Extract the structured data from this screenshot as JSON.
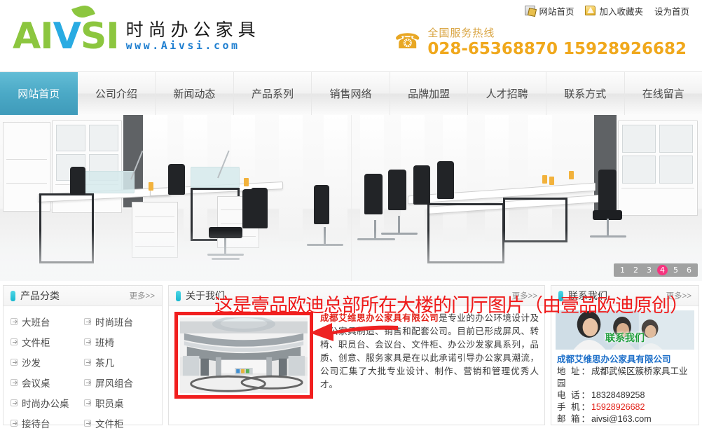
{
  "topbar": {
    "items": [
      {
        "icon": "home-icon",
        "label": "网站首页"
      },
      {
        "icon": "favorite-folder-icon",
        "label": "加入收藏夹"
      },
      {
        "icon": "",
        "label": "设为首页"
      }
    ]
  },
  "brand": {
    "logo_main": "AI",
    "logo_v": "V",
    "logo_tail": "SI",
    "logo_cn": "时尚办公家具",
    "logo_url": "www.Aivsi.com"
  },
  "hotline": {
    "label": "全国服务热线",
    "numbers": "028-65368870  15928926682"
  },
  "nav": {
    "items": [
      {
        "label": "网站首页",
        "active": true
      },
      {
        "label": "公司介绍",
        "active": false
      },
      {
        "label": "新闻动态",
        "active": false
      },
      {
        "label": "产品系列",
        "active": false
      },
      {
        "label": "销售网络",
        "active": false
      },
      {
        "label": "品牌加盟",
        "active": false
      },
      {
        "label": "人才招聘",
        "active": false
      },
      {
        "label": "联系方式",
        "active": false
      },
      {
        "label": "在线留言",
        "active": false
      }
    ]
  },
  "banner": {
    "pages": [
      "1",
      "2",
      "3",
      "4",
      "5",
      "6"
    ],
    "active_page": "4",
    "active_color": "#f6347f"
  },
  "products": {
    "title": "产品分类",
    "more": "更多>>",
    "categories": [
      "大班台",
      "时尚班台",
      "文件柜",
      "班椅",
      "沙发",
      "茶几",
      "会议桌",
      "屏风组合",
      "时尚办公桌",
      "职员桌",
      "接待台",
      "文件柜"
    ]
  },
  "about": {
    "title": "关于我们",
    "more": "更多>>",
    "company_highlight": "成都艾维思办公家具有限公司",
    "body": "是专业的办公环境设计及办公家具制造、销售和配套公司。目前已形成屏风、转椅、职员台、会议台、文件柜、办公沙发家具系列，品质、创意、服务家具是在以此承诺引导办公家具潮流，公司汇集了大批专业设计、制作、营销和管理优秀人才。"
  },
  "contact": {
    "title": "联系我们",
    "banner_caption": "联系我们",
    "company": "成都艾维思办公家具有限公司",
    "address_label": "地 址：",
    "address": "成都武候区簇桥家具工业园",
    "tel_label": "电 话：",
    "tel": "18328489258",
    "mobile_label": "手 机：",
    "mobile": "15928926682",
    "email_label": "邮 箱：",
    "email": "aivsi@163.com"
  },
  "annotation": {
    "text": "这是壹品欧迪总部所在大楼的门厅图片（由壹品欧迪原创）",
    "color": "#ef1b1b"
  }
}
